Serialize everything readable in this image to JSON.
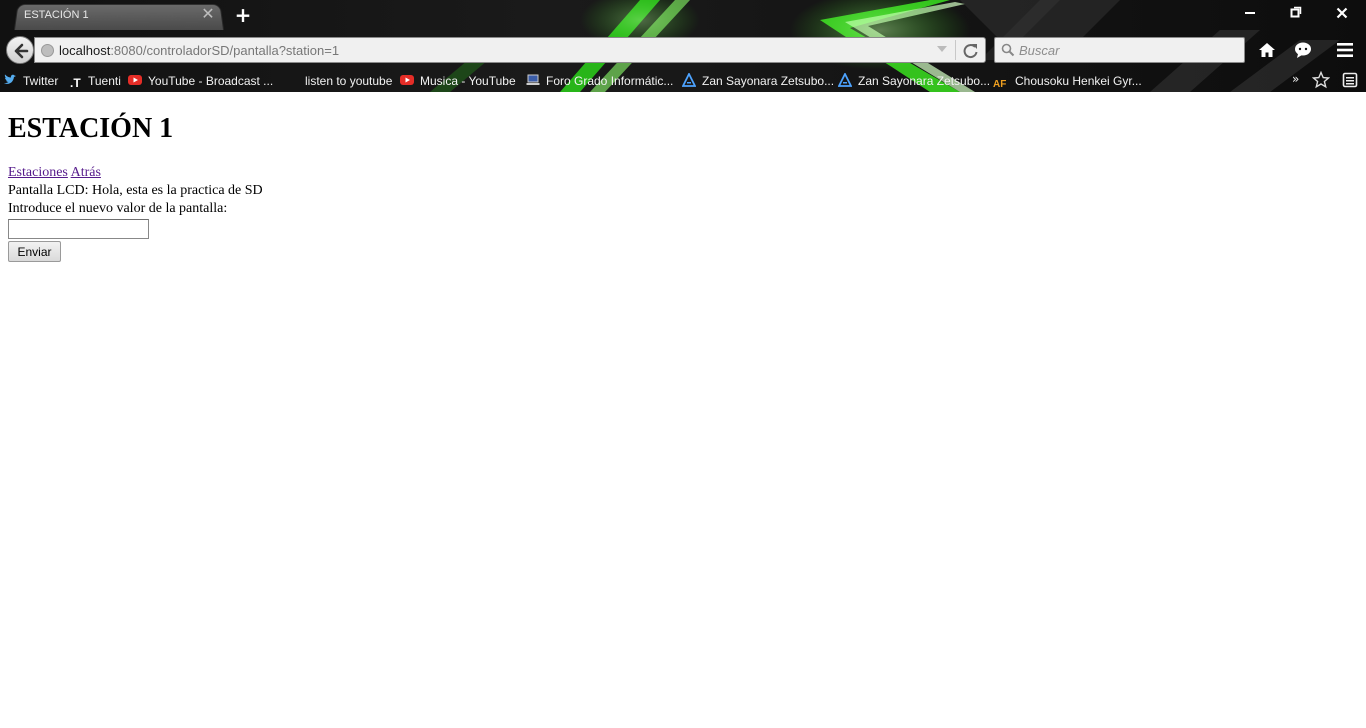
{
  "browser": {
    "tab": {
      "title": "ESTACIÓN 1"
    },
    "address": {
      "host": "localhost",
      "rest": ":8080/controladorSD/pantalla?station=1"
    },
    "search": {
      "placeholder": "Buscar"
    },
    "bookmarks": [
      {
        "label": "Twitter",
        "icon": "twitter-icon"
      },
      {
        "label": "Tuenti",
        "icon": "tuenti-icon"
      },
      {
        "label": "YouTube - Broadcast ...",
        "icon": "youtube-icon"
      },
      {
        "label": "listen to youtube",
        "icon": "none"
      },
      {
        "label": "Musica - YouTube",
        "icon": "youtube-icon"
      },
      {
        "label": "Foro Grado Informátic...",
        "icon": "laptop-icon"
      },
      {
        "label": "Zan Sayonara Zetsubo...",
        "icon": "triangle-logo-icon"
      },
      {
        "label": "Zan Sayonara Zetsubo...",
        "icon": "triangle-logo-icon"
      },
      {
        "label": "Chousoku Henkei Gyr...",
        "icon": "af-logo-icon"
      }
    ],
    "bookmarks_overflow": "»",
    "colors": {
      "theme_green": "#39ff14",
      "chrome_dark": "#0a0a0a",
      "visited_link": "#551a8b"
    }
  },
  "page": {
    "heading": "ESTACIÓN 1",
    "links": {
      "stations": "Estaciones",
      "back": "Atrás"
    },
    "lcd_label": "Pantalla LCD: Hola, esta es la practica de SD",
    "prompt": "Introduce el nuevo valor de la pantalla:",
    "input_value": "",
    "submit_label": "Enviar"
  }
}
